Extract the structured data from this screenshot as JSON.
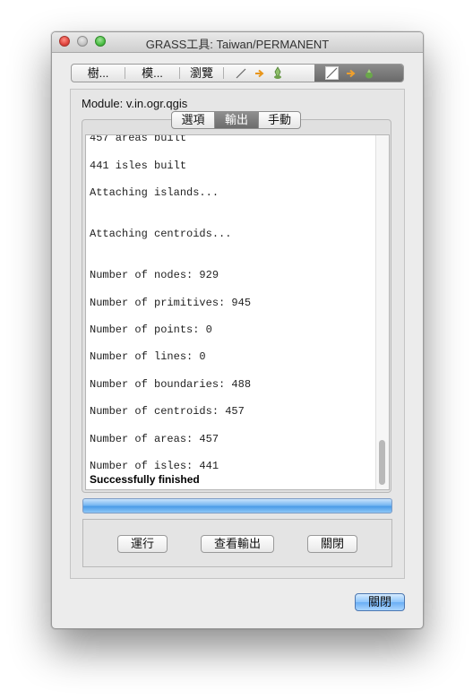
{
  "window": {
    "title": "GRASS工具: Taiwan/PERMANENT"
  },
  "top_tabs": [
    {
      "label": "樹..."
    },
    {
      "label": "模..."
    },
    {
      "label": "瀏覽"
    }
  ],
  "module_label": "Module: v.in.ogr.qgis",
  "segments": [
    {
      "label": "選項",
      "active": false
    },
    {
      "label": "輸出",
      "active": true
    },
    {
      "label": "手動",
      "active": false
    }
  ],
  "output": {
    "lines": [
      "457 areas built",
      "441 isles built",
      "Attaching islands...",
      "Attaching centroids...",
      "Number of nodes: 929",
      "Number of primitives: 945",
      "Number of points: 0",
      "Number of lines: 0",
      "Number of boundaries: 488",
      "Number of centroids: 457",
      "Number of areas: 457",
      "Number of isles: 441"
    ],
    "final": "Successfully finished"
  },
  "progress": {
    "value": 1.0
  },
  "buttons": {
    "run": "運行",
    "view_output": "查看輸出",
    "close": "關閉",
    "dialog_close": "關閉"
  },
  "colors": {
    "accent": "#6aaef5",
    "progress": "#4b9ce8",
    "close_light": "#e0443e",
    "min_light": "#c4c4c4",
    "max_light": "#4cbf45"
  }
}
